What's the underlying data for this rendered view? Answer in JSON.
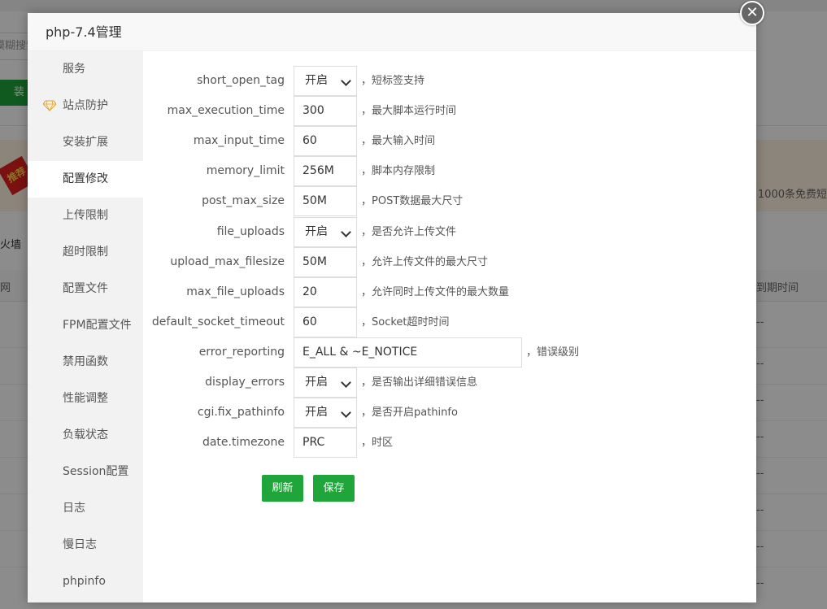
{
  "background": {
    "search_text": "模糊搜索",
    "green_button": "装",
    "badge": "推荐",
    "banner_text": "1000条免费短",
    "tab_label": "火墙",
    "col_left": "网",
    "col_right": "到期时间",
    "dash": "--"
  },
  "dialog": {
    "title": "php-7.4管理",
    "close_label": "✕"
  },
  "sidebar": {
    "items": [
      {
        "label": "服务"
      },
      {
        "label": "站点防护",
        "icon": "diamond-icon"
      },
      {
        "label": "安装扩展"
      },
      {
        "label": "配置修改"
      },
      {
        "label": "上传限制"
      },
      {
        "label": "超时限制"
      },
      {
        "label": "配置文件"
      },
      {
        "label": "FPM配置文件"
      },
      {
        "label": "禁用函数"
      },
      {
        "label": "性能调整"
      },
      {
        "label": "负载状态"
      },
      {
        "label": "Session配置"
      },
      {
        "label": "日志"
      },
      {
        "label": "慢日志"
      },
      {
        "label": "phpinfo"
      }
    ],
    "active_index": 3
  },
  "form": {
    "rows": [
      {
        "label": "short_open_tag",
        "type": "select",
        "value": "开启",
        "hint": "，短标签支持"
      },
      {
        "label": "max_execution_time",
        "type": "input",
        "value": "300",
        "hint": "，最大脚本运行时间"
      },
      {
        "label": "max_input_time",
        "type": "input",
        "value": "60",
        "hint": "，最大输入时间"
      },
      {
        "label": "memory_limit",
        "type": "input",
        "value": "256M",
        "hint": "，脚本内存限制"
      },
      {
        "label": "post_max_size",
        "type": "input",
        "value": "50M",
        "hint": "，POST数据最大尺寸"
      },
      {
        "label": "file_uploads",
        "type": "select",
        "value": "开启",
        "hint": "，是否允许上传文件"
      },
      {
        "label": "upload_max_filesize",
        "type": "input",
        "value": "50M",
        "hint": "，允许上传文件的最大尺寸"
      },
      {
        "label": "max_file_uploads",
        "type": "input",
        "value": "20",
        "hint": "，允许同时上传文件的最大数量"
      },
      {
        "label": "default_socket_timeout",
        "type": "input",
        "value": "60",
        "hint": "，Socket超时时间"
      },
      {
        "label": "error_reporting",
        "type": "input-wide",
        "value": "E_ALL & ~E_NOTICE",
        "hint": "，错误级别"
      },
      {
        "label": "display_errors",
        "type": "select",
        "value": "开启",
        "hint": "，是否输出详细错误信息"
      },
      {
        "label": "cgi.fix_pathinfo",
        "type": "select",
        "value": "开启",
        "hint": "，是否开启pathinfo"
      },
      {
        "label": "date.timezone",
        "type": "input",
        "value": "PRC",
        "hint": "，时区"
      }
    ],
    "refresh_label": "刷新",
    "save_label": "保存"
  },
  "colors": {
    "accent": "#20a53a",
    "sidebar_bg": "#f2f2f2"
  }
}
